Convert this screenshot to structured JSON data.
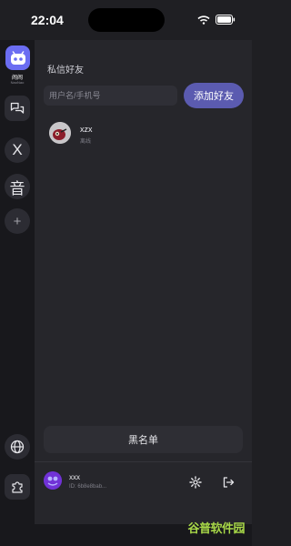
{
  "status_bar": {
    "time": "22:04"
  },
  "rail": {
    "app_name": "闹闹",
    "app_subtitle": "NaoNao",
    "items": [
      {
        "label": "X"
      },
      {
        "label": "音"
      },
      {
        "label": "+"
      }
    ]
  },
  "main": {
    "section_title": "私信好友",
    "search": {
      "placeholder": "用户名/手机号"
    },
    "add_button": "添加好友",
    "friends": [
      {
        "name": "xzx",
        "status": "离线"
      }
    ],
    "blacklist_button": "黑名单"
  },
  "profile": {
    "name": "xxx",
    "id": "ID: 6b8e8bab..."
  },
  "watermark": "谷普软件园"
}
